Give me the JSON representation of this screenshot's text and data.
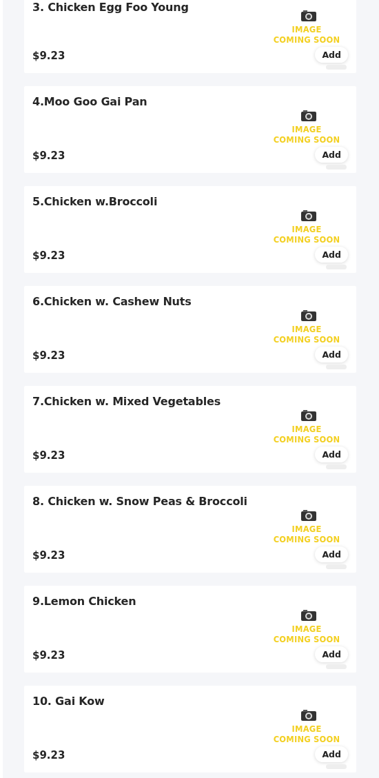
{
  "items": [
    {
      "name": "3. Chicken Egg Foo Young",
      "price": "$9.23",
      "image_text": [
        "IMAGE",
        "COMING SOON"
      ],
      "button": "Add"
    },
    {
      "name": "4.Moo Goo Gai Pan",
      "price": "$9.23",
      "image_text": [
        "IMAGE",
        "COMING SOON"
      ],
      "button": "Add"
    },
    {
      "name": "5.Chicken w.Broccoli",
      "price": "$9.23",
      "image_text": [
        "IMAGE",
        "COMING SOON"
      ],
      "button": "Add"
    },
    {
      "name": "6.Chicken w. Cashew Nuts",
      "price": "$9.23",
      "image_text": [
        "IMAGE",
        "COMING SOON"
      ],
      "button": "Add"
    },
    {
      "name": "7.Chicken w. Mixed Vegetables",
      "price": "$9.23",
      "image_text": [
        "IMAGE",
        "COMING SOON"
      ],
      "button": "Add"
    },
    {
      "name": "8. Chicken w. Snow Peas & Broccoli",
      "price": "$9.23",
      "image_text": [
        "IMAGE",
        "COMING SOON"
      ],
      "button": "Add"
    },
    {
      "name": "9.Lemon Chicken",
      "price": "$9.23",
      "image_text": [
        "IMAGE",
        "COMING SOON"
      ],
      "button": "Add"
    },
    {
      "name": "10. Gai Kow",
      "price": "$9.23",
      "image_text": [
        "IMAGE",
        "COMING SOON"
      ],
      "button": "Add"
    }
  ]
}
